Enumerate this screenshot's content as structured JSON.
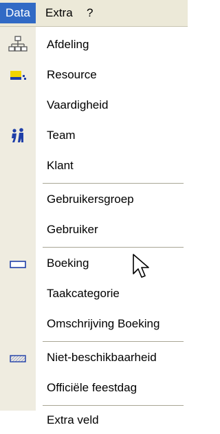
{
  "menubar": {
    "items": [
      "Data",
      "Extra",
      "?"
    ]
  },
  "menu": {
    "items": [
      {
        "label": "Afdeling",
        "icon": "org-chart-icon"
      },
      {
        "label": "Resource",
        "icon": "resource-icon"
      },
      {
        "label": "Vaardigheid",
        "icon": ""
      },
      {
        "label": "Team",
        "icon": "team-icon"
      },
      {
        "label": "Klant",
        "icon": ""
      },
      {
        "label": "Gebruikersgroep",
        "icon": ""
      },
      {
        "label": "Gebruiker",
        "icon": ""
      },
      {
        "label": "Boeking",
        "icon": "booking-icon"
      },
      {
        "label": "Taakcategorie",
        "icon": ""
      },
      {
        "label": "Omschrijving Boeking",
        "icon": ""
      },
      {
        "label": "Niet-beschikbaarheid",
        "icon": "unavailability-icon"
      },
      {
        "label": "Officiële feestdag",
        "icon": ""
      },
      {
        "label": "Extra veld",
        "icon": ""
      }
    ],
    "highlighted": "Taakcategorie"
  },
  "colors": {
    "menubar_bg": "#ece9d8",
    "active_menu_bg": "#316ac5",
    "highlight_bg": "#c1d2ee",
    "gutter_bg": "#efece0"
  }
}
